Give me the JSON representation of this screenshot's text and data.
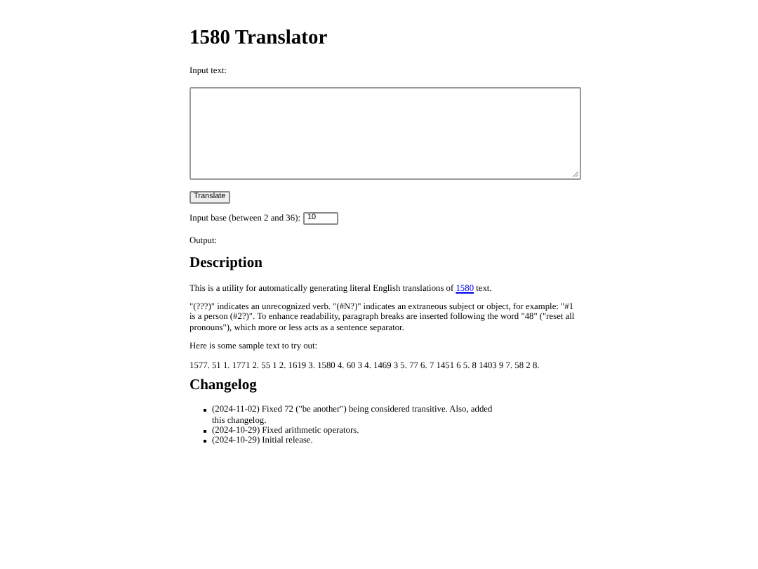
{
  "title": "1580 Translator",
  "input": {
    "label": "Input text:"
  },
  "translate_button": "Translate",
  "base": {
    "label": "Input base (between 2 and 36):",
    "value": "10"
  },
  "output_label": "Output:",
  "description": {
    "heading": "Description",
    "intro": {
      "before": "This is a utility for automatically generating literal English translations of ",
      "link": "1580",
      "after": " text."
    },
    "paragraphs": [
      "\"(???)\" indicates an unrecognized verb. \"(#N?)\" indicates an extraneous subject or object, for example: \"#1 is a person (#2?)\". To enhance readability, paragraph breaks are inserted following the word \"48\" (\"reset all pronouns\"), which more or less acts as a sentence separator.",
      "Here is some sample text to try out:",
      "1577. 51 1. 1771 2. 55 1 2. 1619 3. 1580 4. 60 3 4. 1469 3 5. 77 6. 7 1451 6 5. 8 1403 9 7. 58 2 8."
    ]
  },
  "changelog": {
    "heading": "Changelog",
    "items": [
      "(2024-11-02) Fixed 72 (\"be another\") being considered transitive. Also, added this changelog.",
      "(2024-10-29) Fixed arithmetic operators.",
      "(2024-10-29) Initial release."
    ]
  }
}
